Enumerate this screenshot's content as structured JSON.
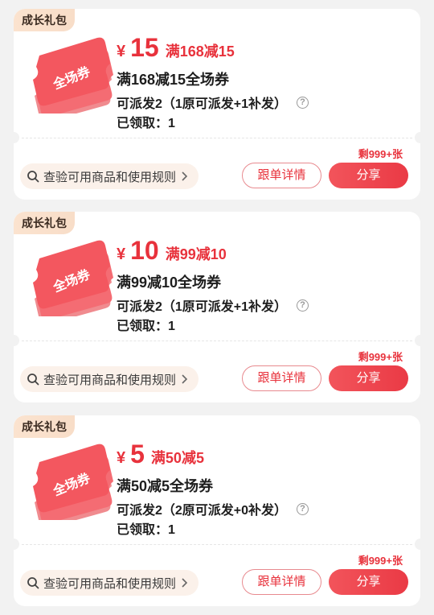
{
  "colors": {
    "accent": "#e8323c",
    "badge_bg": "#fbe3cf",
    "page_bg": "#f2f2f2"
  },
  "coupons": [
    {
      "badge": "成长礼包",
      "art_label": "全场券",
      "price_symbol": "¥",
      "price_value": "15",
      "price_rule": "满168减15",
      "title": "满168减15全场券",
      "dispatch": "可派发2（1原可派发+1补发）",
      "claimed": "已领取：1",
      "remaining": "剩999+张",
      "rules_link": "查验可用商品和使用规则",
      "detail_button": "跟单详情",
      "share_button": "分享"
    },
    {
      "badge": "成长礼包",
      "art_label": "全场券",
      "price_symbol": "¥",
      "price_value": "10",
      "price_rule": "满99减10",
      "title": "满99减10全场券",
      "dispatch": "可派发2（1原可派发+1补发）",
      "claimed": "已领取：1",
      "remaining": "剩999+张",
      "rules_link": "查验可用商品和使用规则",
      "detail_button": "跟单详情",
      "share_button": "分享"
    },
    {
      "badge": "成长礼包",
      "art_label": "全场券",
      "price_symbol": "¥",
      "price_value": "5",
      "price_rule": "满50减5",
      "title": "满50减5全场券",
      "dispatch": "可派发2（2原可派发+0补发）",
      "claimed": "已领取：1",
      "remaining": "剩999+张",
      "rules_link": "查验可用商品和使用规则",
      "detail_button": "跟单详情",
      "share_button": "分享"
    }
  ]
}
